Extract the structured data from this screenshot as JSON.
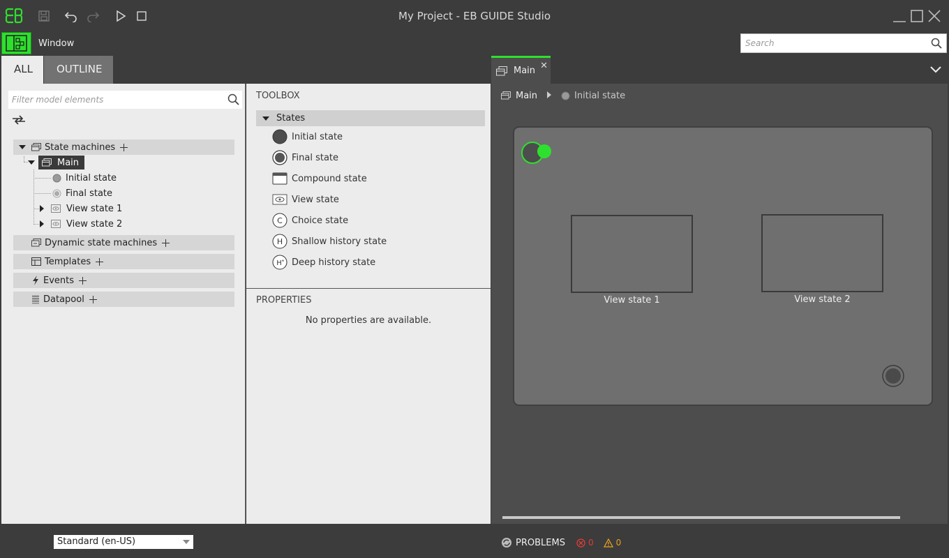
{
  "app": {
    "title": "My Project - EB GUIDE Studio",
    "accent_color": "#2ee02e"
  },
  "toolbar": {
    "icons": [
      "save-icon",
      "undo-icon",
      "redo-icon",
      "play-icon",
      "stop-icon"
    ]
  },
  "menu": {
    "window_label": "Window"
  },
  "search": {
    "placeholder": "Search"
  },
  "left_panel": {
    "tabs": [
      {
        "label": "ALL",
        "active": true
      },
      {
        "label": "OUTLINE",
        "active": false
      }
    ],
    "filter_placeholder": "Filter model elements",
    "tree": {
      "state_machines_label": "State machines",
      "main_label": "Main",
      "children": [
        {
          "label": "Initial state"
        },
        {
          "label": "Final state"
        },
        {
          "label": "View state 1"
        },
        {
          "label": "View state 2"
        }
      ],
      "categories": [
        {
          "label": "Dynamic state machines"
        },
        {
          "label": "Templates"
        },
        {
          "label": "Events"
        },
        {
          "label": "Datapool"
        }
      ]
    }
  },
  "toolbox": {
    "title": "TOOLBOX",
    "group_label": "States",
    "items": [
      {
        "label": "Initial state",
        "icon": "initial-state-icon"
      },
      {
        "label": "Final state",
        "icon": "final-state-icon"
      },
      {
        "label": "Compound state",
        "icon": "compound-state-icon"
      },
      {
        "label": "View state",
        "icon": "view-state-icon"
      },
      {
        "label": "Choice state",
        "icon": "choice-state-icon"
      },
      {
        "label": "Shallow history state",
        "icon": "shallow-history-icon"
      },
      {
        "label": "Deep history state",
        "icon": "deep-history-icon"
      }
    ]
  },
  "properties": {
    "title": "PROPERTIES",
    "empty_text": "No properties are available."
  },
  "editor": {
    "tab_label": "Main",
    "breadcrumb": {
      "root": "Main",
      "current": "Initial state"
    },
    "canvas": {
      "view_state_1": "View state 1",
      "view_state_2": "View state 2"
    }
  },
  "statusbar": {
    "language": "Standard (en-US)",
    "problems_label": "PROBLEMS",
    "error_count": "0",
    "warning_count": "0"
  }
}
